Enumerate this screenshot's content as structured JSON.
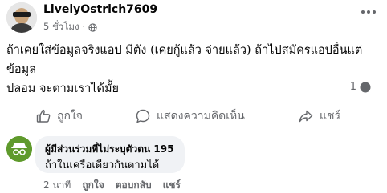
{
  "post": {
    "author": "LivelyOstrich7609",
    "time": "5 ชั่วโมง ·",
    "text_line1": "ถ้าเคยใส่ข้อมูลจริงแอป มีตัง (เคยกู้แล้ว จ่ายแล้ว) ถ้าไปสมัครแอปอื่นแต่ข้อมูล",
    "text_line2": "ปลอม จะตามเราได้มั้ย",
    "comment_count": "1"
  },
  "actions": {
    "like": "ถูกใจ",
    "comment": "แสดงความคิดเห็น",
    "share": "แชร์"
  },
  "comment": {
    "author": "ผู้มีส่วนร่วมที่ไม่ระบุตัวตน 195",
    "text": "ถ้าในเครือเดียวกันตามได้",
    "time": "2 นาที",
    "like": "ถูกใจ",
    "reply": "ตอบกลับ",
    "share": "แชร์"
  }
}
